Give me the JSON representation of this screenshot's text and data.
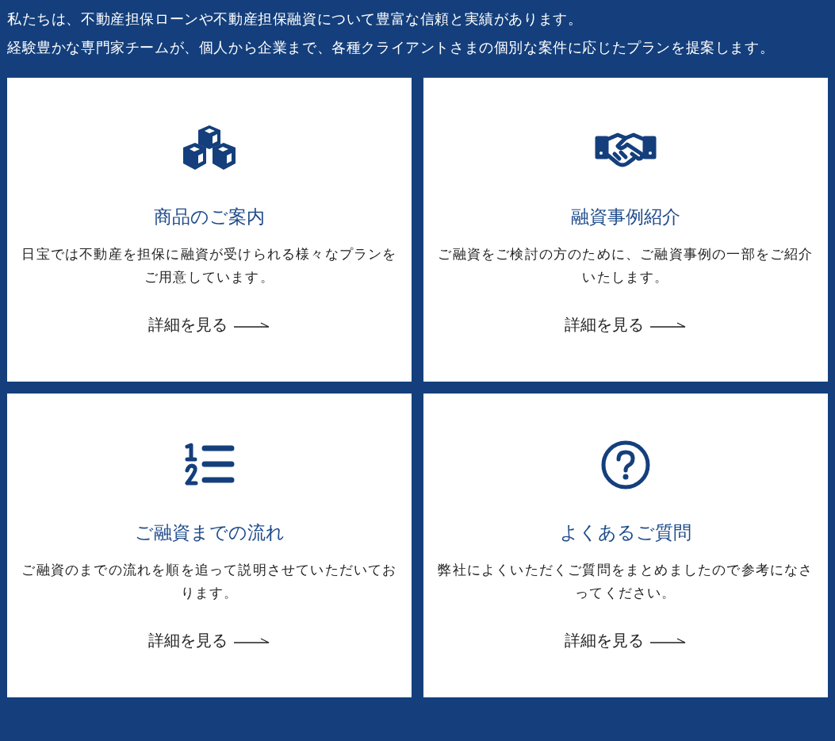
{
  "intro": [
    "私たちは、不動産担保ローンや不動産担保融資について豊富な信頼と実績があります。",
    "経験豊かな専門家チームが、個人から企業まで、各種クライアントさまの個別な案件に応じたプランを提案します。"
  ],
  "cards": [
    {
      "title": "商品のご案内",
      "description": "日宝では不動産を担保に融資が受けられる様々なプランをご用意しています。",
      "link": "詳細を見る"
    },
    {
      "title": "融資事例紹介",
      "description": "ご融資をご検討の方のために、ご融資事例の一部をご紹介いたします。",
      "link": "詳細を見る"
    },
    {
      "title": "ご融資までの流れ",
      "description": "ご融資のまでの流れを順を追って説明させていただいております。",
      "link": "詳細を見る"
    },
    {
      "title": "よくあるご質問",
      "description": "弊社によくいただくご質問をまとめましたので参考になさってください。",
      "link": "詳細を見る"
    }
  ]
}
